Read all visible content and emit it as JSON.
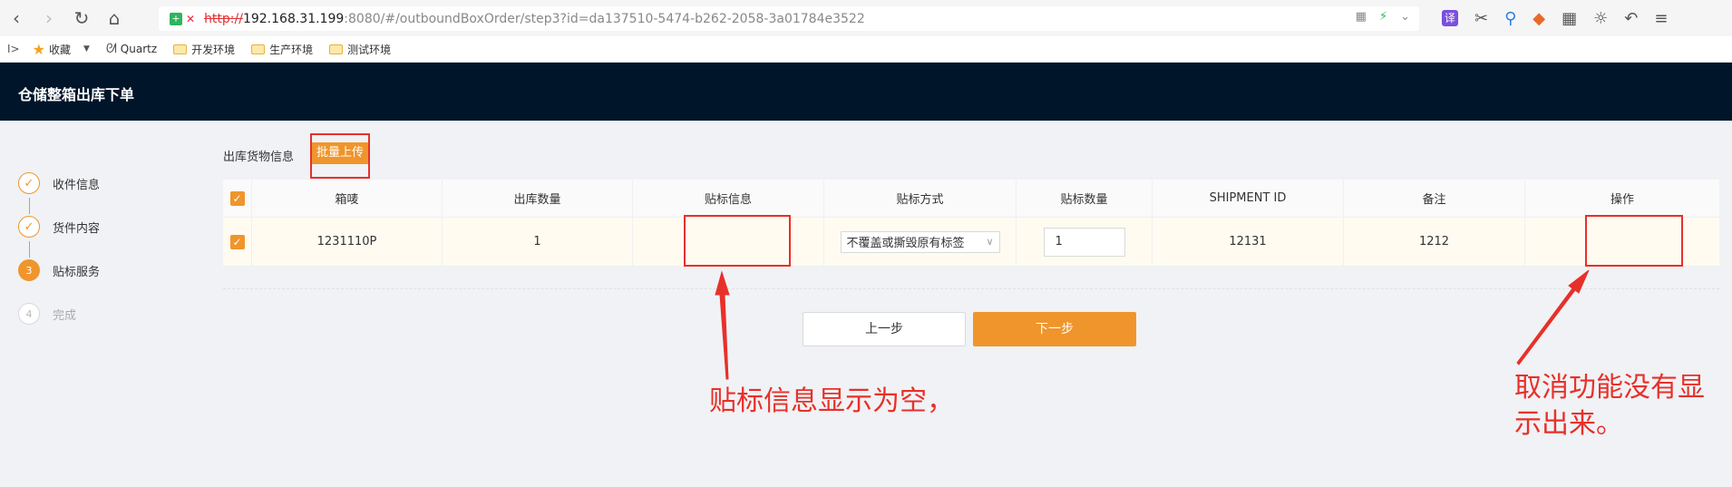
{
  "browser": {
    "url_scheme": "http://",
    "url_host": "192.168.31.199",
    "url_rest": ":8080/#/outboundBoxOrder/step3?id=da137510-5474-b262-2058-3a01784e3522",
    "secure_glyph": "+",
    "translate_glyph": "译"
  },
  "bookmarks": {
    "side": "I>",
    "items": [
      "收藏",
      "Quartz",
      "开发环境",
      "生产环境",
      "测试环境"
    ]
  },
  "app": {
    "title": "仓储整箱出库下单"
  },
  "steps": [
    {
      "label": "收件信息",
      "status": "done",
      "mark": "✓"
    },
    {
      "label": "货件内容",
      "status": "done",
      "mark": "✓"
    },
    {
      "label": "贴标服务",
      "status": "active",
      "mark": "3"
    },
    {
      "label": "完成",
      "status": "wait",
      "mark": "4"
    }
  ],
  "section": {
    "title": "出库货物信息",
    "upload_label": "批量上传"
  },
  "table": {
    "headers": [
      "箱唛",
      "出库数量",
      "贴标信息",
      "贴标方式",
      "贴标数量",
      "SHIPMENT ID",
      "备注",
      "操作"
    ],
    "row": {
      "box_mark": "1231110P",
      "qty": "1",
      "label_info": "",
      "label_method": "不覆盖或撕毁原有标签",
      "label_qty": "1",
      "shipment_id": "12131",
      "remark": "1212",
      "action": ""
    }
  },
  "buttons": {
    "prev": "上一步",
    "next": "下一步"
  },
  "annotations": {
    "label_empty": "贴标信息显示为空，",
    "cancel_missing": "取消功能没有显示出来。"
  },
  "colors": {
    "accent": "#f0952c",
    "header_bg": "#001529",
    "annotation": "#e8302a"
  }
}
